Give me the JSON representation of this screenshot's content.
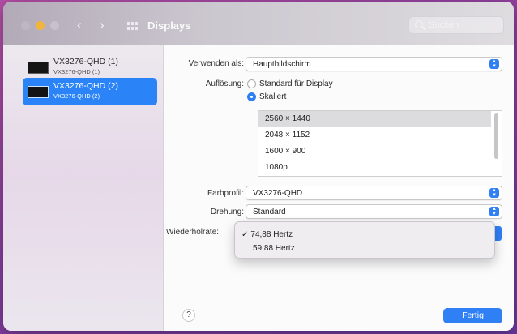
{
  "window": {
    "title": "Displays",
    "search_placeholder": "Suchen"
  },
  "sidebar": {
    "items": [
      {
        "name": "VX3276-QHD (1)",
        "sub": "VX3276-QHD (1)",
        "selected": false
      },
      {
        "name": "VX3276-QHD (2)",
        "sub": "VX3276-QHD (2)",
        "selected": true
      }
    ]
  },
  "settings": {
    "use_as_label": "Verwenden als:",
    "use_as_value": "Hauptbildschirm",
    "resolution_label": "Auflösung:",
    "resolution_default": "Standard für Display",
    "resolution_scaled": "Skaliert",
    "resolutions": [
      "2560 × 1440",
      "2048 × 1152",
      "1600 × 900",
      "1080p"
    ],
    "selected_resolution_index": 0,
    "color_profile_label": "Farbprofil:",
    "color_profile_value": "VX3276-QHD",
    "rotation_label": "Drehung:",
    "rotation_value": "Standard",
    "refresh_label": "Wiederholrate:",
    "refresh_options": [
      "74,88 Hertz",
      "59,88 Hertz"
    ],
    "refresh_selected": "74,88 Hertz"
  },
  "footer": {
    "help_label": "?",
    "done_label": "Fertig"
  },
  "colors": {
    "accent": "#2f7ff5",
    "traffic_yellow": "#f1b43c"
  }
}
